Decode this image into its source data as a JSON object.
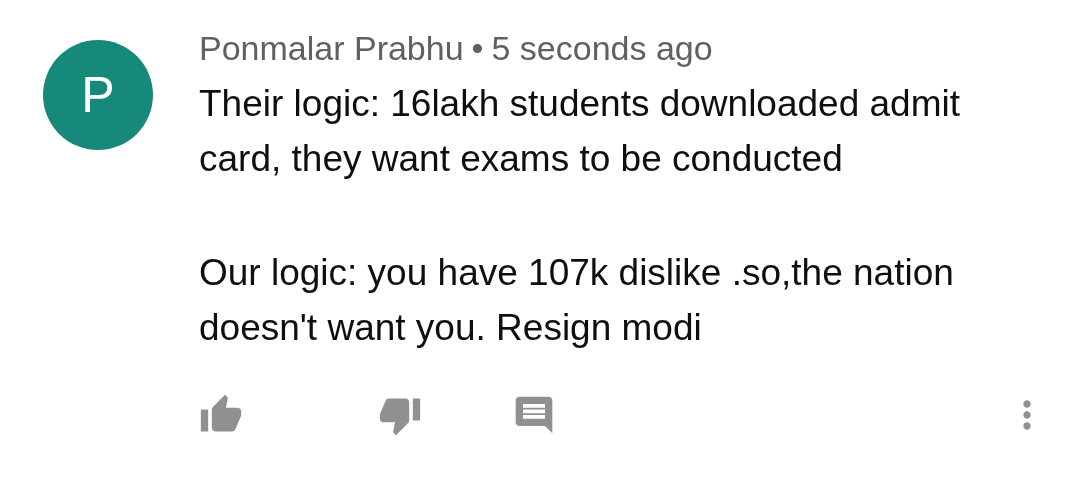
{
  "comment": {
    "avatar_letter": "P",
    "author": "Ponmalar Prabhu",
    "separator": "•",
    "time": "5 seconds ago",
    "paragraphs": [
      "Their logic: 16lakh students downloaded admit card, they want exams to be conducted",
      "Our logic: you have 107k dislike .so,the nation doesn't want you. Resign modi"
    ]
  }
}
